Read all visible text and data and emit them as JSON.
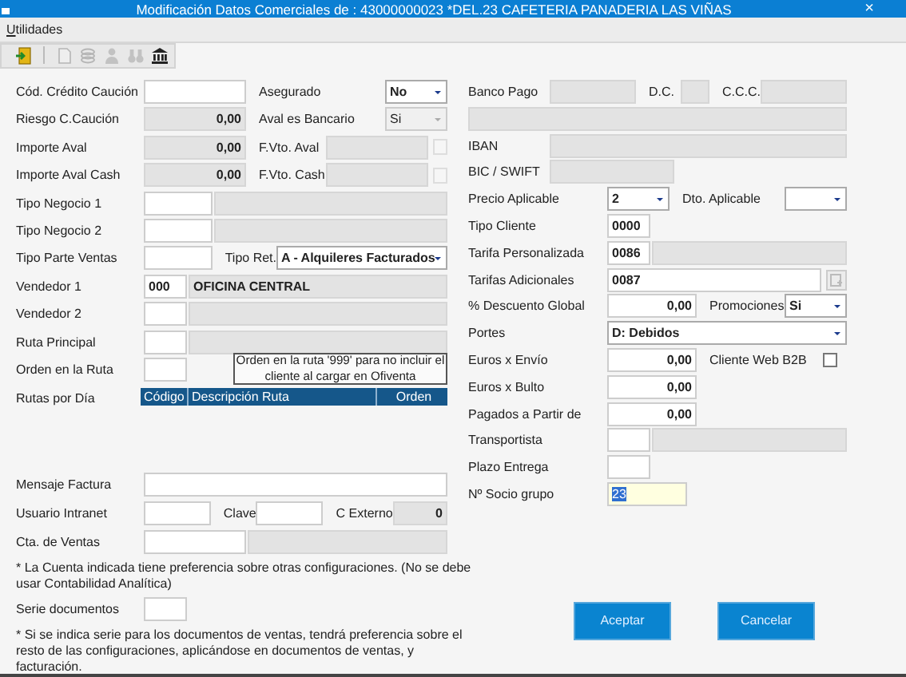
{
  "window": {
    "title": "Modificación Datos Comerciales de : 43000000023 *DEL.23 CAFETERIA PANADERIA LAS VIÑAS",
    "close": "×"
  },
  "menu": [
    {
      "label": "Utilidades"
    }
  ],
  "toolbar": [
    {
      "kind": "exit",
      "disabled": false
    },
    {
      "kind": "document",
      "disabled": true
    },
    {
      "kind": "layers",
      "disabled": true
    },
    {
      "kind": "user",
      "disabled": true
    },
    {
      "kind": "binoculars",
      "disabled": true
    },
    {
      "kind": "bank",
      "disabled": false
    }
  ],
  "left": {
    "rows": [
      {
        "label": "Cód. Crédito Caución",
        "controls": [
          {
            "kind": "entry",
            "disabled": false
          },
          {
            "kind": "label",
            "text": "Asegurado"
          },
          {
            "kind": "select",
            "value": "No",
            "disabled": false
          }
        ]
      },
      {
        "label": "Riesgo C.Caución",
        "controls": [
          {
            "kind": "amount",
            "value": "0,00",
            "disabled": true
          },
          {
            "kind": "label",
            "text": "Aval es Bancario"
          },
          {
            "kind": "select",
            "value": "Si",
            "disabled": true
          }
        ]
      },
      {
        "label": "Importe Aval",
        "controls": [
          {
            "kind": "amount",
            "value": "0,00",
            "disabled": true
          },
          {
            "kind": "label",
            "text": "F.Vto. Aval"
          },
          {
            "kind": "date",
            "disabled": true
          }
        ]
      },
      {
        "label": "Importe Aval Cash",
        "controls": [
          {
            "kind": "amount",
            "value": "0,00",
            "disabled": true
          },
          {
            "kind": "label",
            "text": "F.Vto. Cash"
          },
          {
            "kind": "date",
            "disabled": true
          }
        ]
      },
      {
        "label": "Tipo Negocio 1",
        "controls": [
          {
            "kind": "code",
            "disabled": false
          },
          {
            "kind": "desc",
            "disabled": true
          }
        ]
      },
      {
        "label": "Tipo Negocio 2",
        "controls": [
          {
            "kind": "code",
            "disabled": false
          },
          {
            "kind": "desc",
            "disabled": true
          }
        ]
      },
      {
        "label": "Tipo Parte Ventas",
        "controls": [
          {
            "kind": "code",
            "disabled": false
          },
          {
            "kind": "label",
            "text": "Tipo Ret."
          },
          {
            "kind": "combo",
            "value": "A - Alquileres Facturados",
            "disabled": false
          }
        ]
      },
      {
        "label": "Vendedor 1",
        "controls": [
          {
            "kind": "key",
            "value": "000",
            "disabled": false
          },
          {
            "kind": "desc",
            "value": "OFICINA CENTRAL",
            "disabled": true
          }
        ]
      },
      {
        "label": "Vendedor 2",
        "controls": [
          {
            "kind": "key",
            "disabled": false
          },
          {
            "kind": "desc",
            "disabled": true
          }
        ]
      },
      {
        "label": "Ruta Principal",
        "controls": [
          {
            "kind": "key",
            "disabled": false
          },
          {
            "kind": "desc",
            "disabled": true
          }
        ]
      },
      {
        "label": "Orden en la Ruta",
        "controls": [
          {
            "kind": "key",
            "disabled": false
          },
          {
            "kind": "note",
            "text": "Orden en la ruta '999' para no incluir el cliente al cargar en Ofiventa"
          }
        ]
      }
    ],
    "routes": {
      "label": "Rutas por Día",
      "columns": [
        "Código",
        "Descripción Ruta",
        "Orden"
      ]
    },
    "extra": [
      {
        "kind": "row",
        "label": "Mensaje Factura",
        "controls": [
          {
            "kind": "wide",
            "disabled": false
          }
        ]
      },
      {
        "kind": "row",
        "label": "Usuario Intranet",
        "controls": [
          {
            "kind": "code",
            "disabled": false
          },
          {
            "kind": "label",
            "text": "Clave"
          },
          {
            "kind": "code",
            "disabled": false
          },
          {
            "kind": "label",
            "text": "C Externo"
          },
          {
            "kind": "number",
            "value": "0",
            "disabled": true
          }
        ]
      },
      {
        "kind": "row",
        "label": "Cta. de Ventas",
        "controls": [
          {
            "kind": "entry",
            "disabled": false
          },
          {
            "kind": "desc",
            "disabled": true
          }
        ]
      },
      {
        "kind": "note",
        "text": "* La Cuenta indicada tiene preferencia sobre otras configuraciones. (No se debe usar Contabilidad Analítica)"
      },
      {
        "kind": "row",
        "label": "Serie documentos",
        "controls": [
          {
            "kind": "key",
            "disabled": false
          }
        ]
      },
      {
        "kind": "note",
        "text": "* Si se indica serie para los documentos de ventas, tendrá preferencia sobre el resto de las configuraciones, aplicándose en documentos de ventas, y facturación."
      }
    ]
  },
  "bank": {
    "rows": [
      {
        "label": "Banco Pago",
        "controls": [
          {
            "kind": "entry",
            "disabled": true
          },
          {
            "kind": "label",
            "text": "D.C."
          },
          {
            "kind": "digit",
            "disabled": true
          },
          {
            "kind": "label",
            "text": "C.C.C."
          },
          {
            "kind": "entry",
            "disabled": true
          }
        ]
      },
      {
        "controls": [
          {
            "kind": "wide",
            "disabled": true
          }
        ]
      },
      {
        "label": "IBAN",
        "controls": [
          {
            "kind": "wide",
            "disabled": true
          }
        ]
      },
      {
        "label": "BIC / SWIFT",
        "controls": [
          {
            "kind": "swift",
            "disabled": true
          }
        ]
      }
    ]
  },
  "terms": {
    "rows": [
      {
        "label": "Precio Aplicable",
        "controls": [
          {
            "kind": "select",
            "value": "2",
            "disabled": false
          },
          {
            "kind": "label",
            "text": "Dto. Aplicable"
          },
          {
            "kind": "select",
            "disabled": false
          }
        ]
      },
      {
        "label": "Tipo Cliente",
        "controls": [
          {
            "kind": "key",
            "value": "0000",
            "disabled": false
          }
        ]
      },
      {
        "label": "Tarifa Personalizada",
        "controls": [
          {
            "kind": "key",
            "value": "0086",
            "disabled": false
          },
          {
            "kind": "desc",
            "disabled": true
          }
        ]
      },
      {
        "label": "Tarifas Adicionales",
        "controls": [
          {
            "kind": "wide",
            "value": "0087",
            "disabled": false
          },
          {
            "kind": "picker",
            "disabled": true
          }
        ]
      },
      {
        "label": "% Descuento Global",
        "controls": [
          {
            "kind": "amount",
            "value": "0,00",
            "disabled": false
          },
          {
            "kind": "label",
            "text": "Promociones"
          },
          {
            "kind": "select",
            "value": "Si",
            "disabled": false
          }
        ]
      },
      {
        "label": "Portes",
        "controls": [
          {
            "kind": "dropdown",
            "value": "D: Debidos",
            "disabled": false
          }
        ]
      },
      {
        "label": "Euros x Envío",
        "controls": [
          {
            "kind": "amount",
            "value": "0,00",
            "disabled": false
          },
          {
            "kind": "label",
            "text": "Cliente Web B2B"
          },
          {
            "kind": "check",
            "checked": false
          }
        ]
      },
      {
        "label": "Euros x Bulto",
        "controls": [
          {
            "kind": "amount",
            "value": "0,00",
            "disabled": false
          }
        ]
      },
      {
        "label": "Pagados a Partir de",
        "controls": [
          {
            "kind": "amount",
            "value": "0,00",
            "disabled": false
          }
        ]
      },
      {
        "label": "Transportista",
        "controls": [
          {
            "kind": "key",
            "disabled": false
          },
          {
            "kind": "desc",
            "disabled": true
          }
        ]
      },
      {
        "label": "Plazo Entrega",
        "controls": [
          {
            "kind": "key",
            "disabled": false
          }
        ]
      },
      {
        "label": "Nº Socio grupo",
        "controls": [
          {
            "kind": "focused",
            "value": "23"
          }
        ]
      }
    ]
  },
  "buttons": [
    {
      "label": "Aceptar"
    },
    {
      "label": "Cancelar"
    }
  ]
}
